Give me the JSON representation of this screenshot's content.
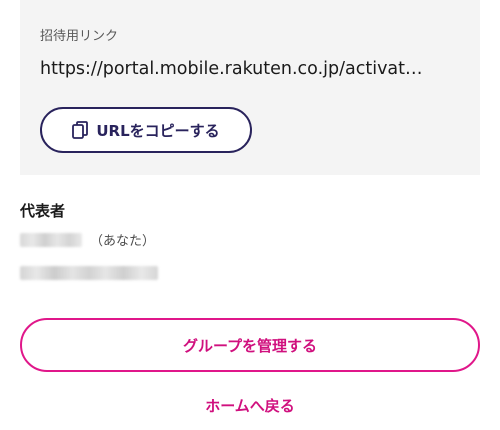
{
  "invite": {
    "label": "招待用リンク",
    "url": "https://portal.mobile.rakuten.co.jp/activat…",
    "copy_button_label": "URLをコピーする",
    "copy_icon": "copy-icon"
  },
  "representative": {
    "title": "代表者",
    "you_label": "（あなた）"
  },
  "actions": {
    "manage_group_label": "グループを管理する",
    "back_home_label": "ホームへ戻る"
  },
  "colors": {
    "accent_navy": "#29235c",
    "accent_magenta": "#d0107e",
    "card_background": "#f4f4f4"
  }
}
